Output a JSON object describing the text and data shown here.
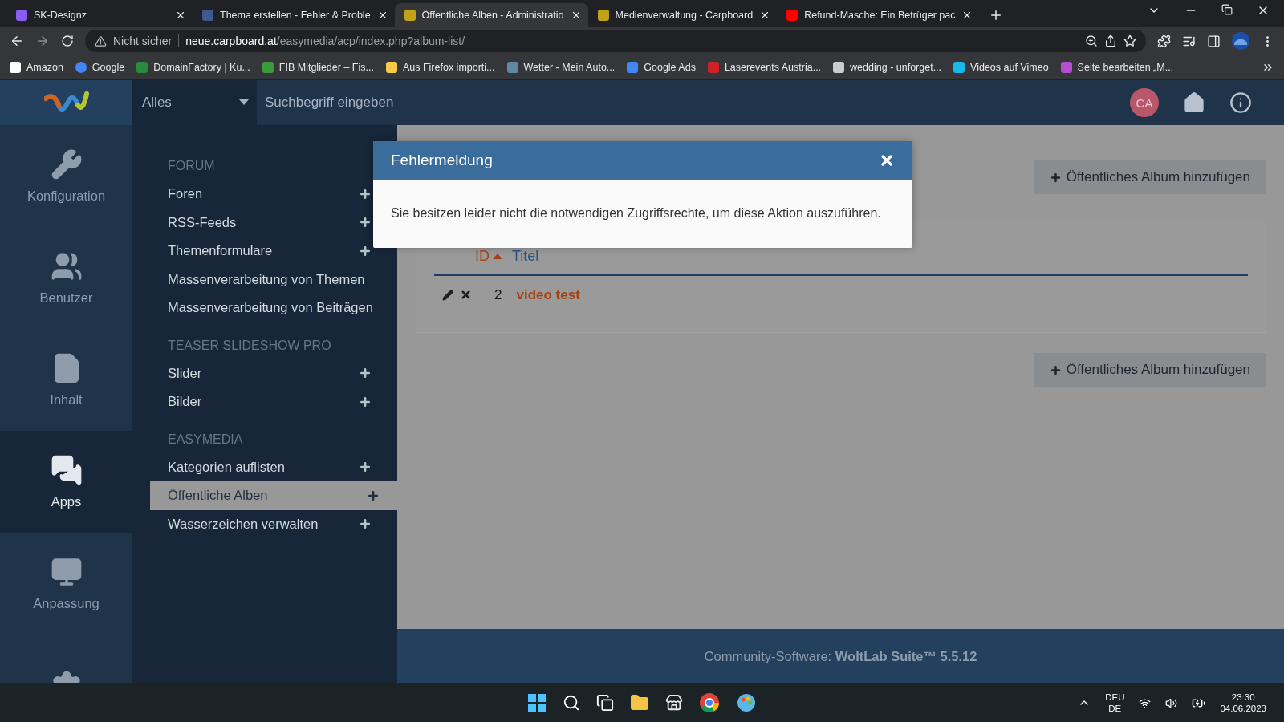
{
  "browser": {
    "tabs": [
      {
        "title": "SK-Designz",
        "selected": false
      },
      {
        "title": "Thema erstellen - Fehler & Proble",
        "selected": false
      },
      {
        "title": "Öffentliche Alben - Administratio",
        "selected": true
      },
      {
        "title": "Medienverwaltung - Carpboard",
        "selected": false
      },
      {
        "title": "Refund-Masche: Ein Betrüger pac",
        "selected": false
      }
    ],
    "address": {
      "security": "Nicht sicher",
      "host": "neue.carpboard.at",
      "path": "/easymedia/acp/index.php?album-list/"
    },
    "bookmarks": [
      "Amazon",
      "Google",
      "DomainFactory | Ku...",
      "FIB Mitglieder – Fis...",
      "Aus Firefox importi...",
      "Wetter - Mein Auto...",
      "Google Ads",
      "Laserevents Austria...",
      "wedding - unforget...",
      "Videos auf Vimeo",
      "Seite bearbeiten „M..."
    ]
  },
  "header": {
    "scope": "Alles",
    "search": {
      "placeholder": "Suchbegriff eingeben"
    },
    "avatar": "CA"
  },
  "main_menu": [
    {
      "label": "Konfiguration",
      "selected": false
    },
    {
      "label": "Benutzer",
      "selected": false
    },
    {
      "label": "Inhalt",
      "selected": false
    },
    {
      "label": "Apps",
      "selected": true
    },
    {
      "label": "Anpassung",
      "selected": false
    },
    {
      "selected": false
    }
  ],
  "sub_menu": [
    {
      "heading": "FORUM",
      "items": [
        {
          "label": "Foren",
          "selected": false,
          "addable": true
        },
        {
          "label": "RSS-Feeds",
          "selected": false,
          "addable": true
        },
        {
          "label": "Themenformulare",
          "selected": false,
          "addable": true
        },
        {
          "label": "Massenverarbeitung von Themen",
          "selected": false
        },
        {
          "label": "Massenverarbeitung von Beiträgen",
          "selected": false
        }
      ]
    },
    {
      "heading": "TEASER SLIDESHOW PRO",
      "items": [
        {
          "label": "Slider",
          "selected": false,
          "addable": true
        },
        {
          "label": "Bilder",
          "selected": false,
          "addable": true
        }
      ]
    },
    {
      "heading": "EASYMEDIA",
      "items": [
        {
          "label": "Kategorien auflisten",
          "selected": false,
          "addable": true
        },
        {
          "label": "Öffentliche Alben",
          "selected": true,
          "addable": true
        },
        {
          "label": "Wasserzeichen verwalten",
          "selected": false,
          "addable": true
        }
      ]
    }
  ],
  "content": {
    "add_button_top": "Öffentliches Album hinzufügen",
    "table": {
      "columns": [
        {
          "label": "ID",
          "sorted": true
        },
        {
          "label": "Titel",
          "sorted": false
        }
      ],
      "rows": [
        {
          "id": "2",
          "title": "video test"
        }
      ]
    },
    "add_button_bottom": "Öffentliches Album hinzufügen"
  },
  "dialog": {
    "title": "Fehlermeldung",
    "message": "Sie besitzen leider nicht die notwendigen Zugriffsrechte, um diese Aktion auszuführen."
  },
  "footer": "Community-Software: **WoltLab Suite™ 5.5.12**",
  "taskbar": {
    "language": "DEU",
    "layout": "DE",
    "time": "23:30",
    "date": "04.06.2023"
  }
}
